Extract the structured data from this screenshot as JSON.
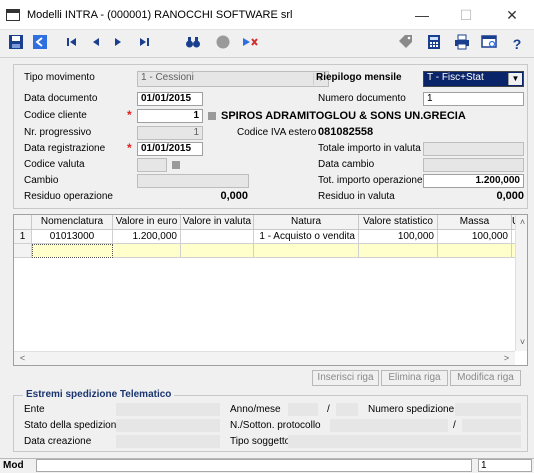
{
  "window": {
    "title": "Modelli INTRA  -  (000001) RANOCCHI SOFTWARE srl",
    "minimize": "—",
    "maximize": "☐",
    "close": "✕"
  },
  "toolbar": {
    "icons": [
      "save-icon",
      "exit-icon",
      "first-record-icon",
      "previous-record-icon",
      "next-record-icon",
      "last-record-icon",
      "search-binoculars-icon",
      "circle-icon",
      "delete-icon",
      "tag-icon",
      "calculator-icon",
      "printer-icon",
      "preview-icon",
      "help-icon"
    ]
  },
  "form": {
    "tipo_movimento_label": "Tipo movimento",
    "tipo_movimento_value": "1  -  Cessioni",
    "riepilogo_label": "Riepilogo mensile",
    "riepilogo_value": "T  -  Fisc+Stat",
    "data_documento_label": "Data documento",
    "data_documento_value": "01/01/2015",
    "numero_documento_label": "Numero documento",
    "numero_documento_value": "1",
    "codice_cliente_label": "Codice cliente",
    "codice_cliente_value": "1",
    "cliente_nome": "SPIROS ADRAMITOGLOU & SONS UN.",
    "cliente_paese": "GRECIA",
    "nr_progressivo_label": "Nr. progressivo",
    "nr_progressivo_value": "1",
    "codice_iva_estero_label": "Codice IVA estero",
    "codice_iva_estero_value": "081082558",
    "data_registrazione_label": "Data registrazione",
    "data_registrazione_value": "01/01/2015",
    "totale_importo_valuta_label": "Totale importo in valuta",
    "codice_valuta_label": "Codice valuta",
    "data_cambio_label": "Data cambio",
    "cambio_label": "Cambio",
    "tot_importo_operazione_label": "Tot. importo operazione",
    "tot_importo_operazione_value": "1.200,000",
    "residuo_operazione_label": "Residuo operazione",
    "residuo_operazione_value": "0,000",
    "residuo_valuta_label": "Residuo in valuta",
    "residuo_valuta_value": "0,000"
  },
  "grid": {
    "headers": [
      "Nomenclatura",
      "Valore in euro",
      "Valore in valuta",
      "Natura",
      "Valore statistico",
      "Massa",
      "U"
    ],
    "rows": [
      {
        "index": "1",
        "nomenclatura": "01013000",
        "valore_euro": "1.200,000",
        "valore_valuta": "",
        "natura": "1  -  Acquisto o vendita",
        "valore_statistico": "100,000",
        "massa": "100,000"
      }
    ]
  },
  "buttons": {
    "inserisci": "Inserisci riga",
    "elimina": "Elimina riga",
    "modifica": "Modifica riga"
  },
  "telematico": {
    "title": "Estremi spedizione Telematico",
    "ente_label": "Ente",
    "anno_mese_label": "Anno/mese",
    "anno_mese_sep": "/",
    "numero_spedizione_label": "Numero spedizione",
    "stato_label": "Stato della spedizione",
    "protocollo_label": "N./Sotton. protocollo",
    "protocollo_sep": "/",
    "data_creazione_label": "Data creazione",
    "tipo_soggetto_label": "Tipo soggetto"
  },
  "status": {
    "mode": "Mod",
    "record": "1"
  },
  "colors": {
    "required_marker": "#e02020",
    "row_highlight": "#ffffcc",
    "toolbar_icon": "#1a3f8f"
  }
}
